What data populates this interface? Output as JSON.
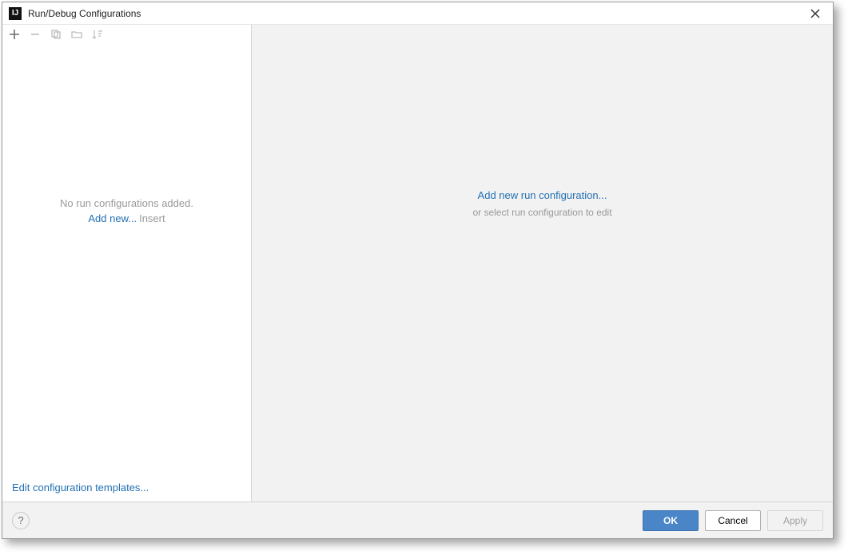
{
  "window": {
    "title": "Run/Debug Configurations"
  },
  "sidebar": {
    "empty_text": "No run configurations added.",
    "add_new_label": "Add new...",
    "add_new_hint": "Insert",
    "edit_templates_label": "Edit configuration templates..."
  },
  "main": {
    "add_link": "Add new run configuration...",
    "hint": "or select run configuration to edit"
  },
  "footer": {
    "help_label": "?",
    "ok_label": "OK",
    "cancel_label": "Cancel",
    "apply_label": "Apply"
  }
}
